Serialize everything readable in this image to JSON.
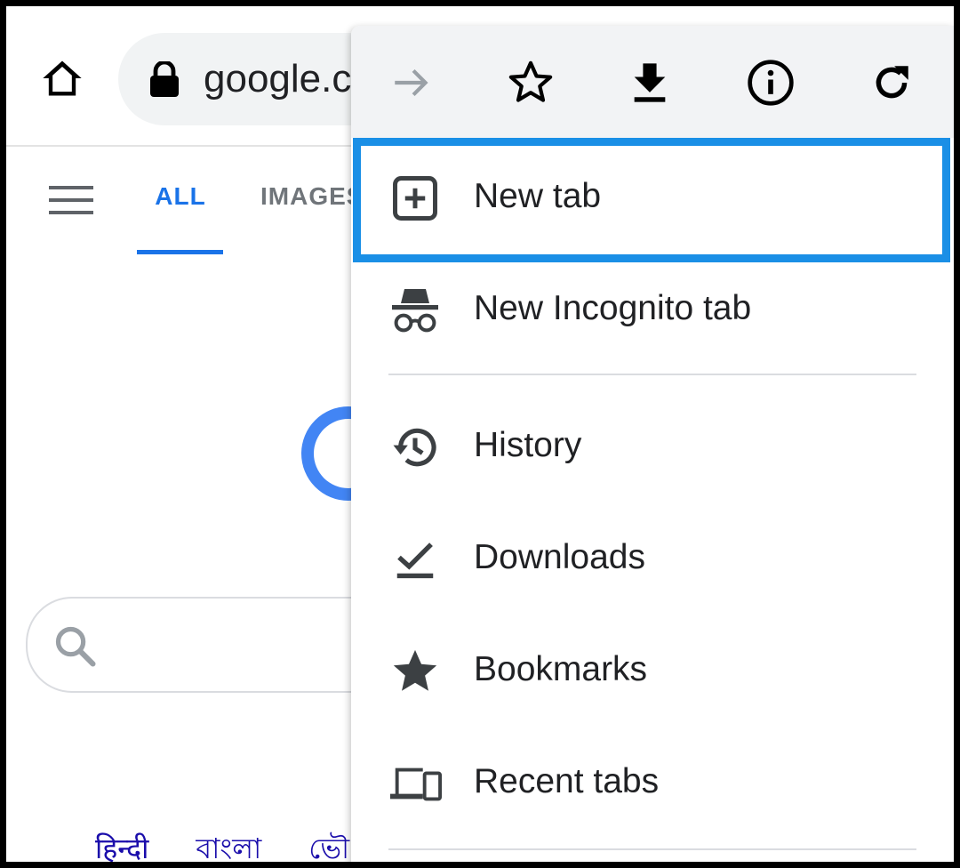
{
  "browser": {
    "url_text": "google.co",
    "home_icon": "home-icon",
    "lock_icon": "lock-icon"
  },
  "page": {
    "tabs": [
      {
        "label": "ALL",
        "active": true
      },
      {
        "label": "IMAGES",
        "active": false
      }
    ],
    "languages": [
      "हिन्दी",
      "বাংলা",
      "ভৌ"
    ]
  },
  "menu": {
    "toolbar": [
      {
        "name": "forward-icon",
        "enabled": false
      },
      {
        "name": "star-outline-icon",
        "enabled": true
      },
      {
        "name": "download-icon",
        "enabled": true
      },
      {
        "name": "info-icon",
        "enabled": true
      },
      {
        "name": "refresh-icon",
        "enabled": true
      }
    ],
    "items": [
      {
        "label": "New tab",
        "icon": "new-tab-icon",
        "highlighted": true
      },
      {
        "label": "New Incognito tab",
        "icon": "incognito-icon"
      },
      {
        "label": "History",
        "icon": "history-icon"
      },
      {
        "label": "Downloads",
        "icon": "downloads-check-icon"
      },
      {
        "label": "Bookmarks",
        "icon": "star-filled-icon"
      },
      {
        "label": "Recent tabs",
        "icon": "devices-icon"
      }
    ]
  },
  "colors": {
    "accent_blue": "#1a73e8",
    "highlight_border": "#1a8fe6",
    "text_primary": "#202124",
    "toolbar_bg": "#f2f3f5"
  }
}
